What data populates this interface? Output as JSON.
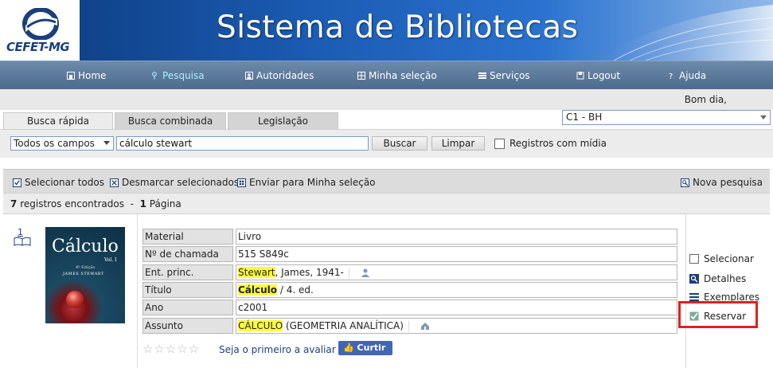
{
  "header": {
    "logo_text": "CEFET-MG",
    "site_title": "Sistema de Bibliotecas"
  },
  "nav": {
    "items": [
      {
        "label": "Home",
        "icon": "home-icon",
        "active": false
      },
      {
        "label": "Pesquisa",
        "icon": "search-icon",
        "active": true
      },
      {
        "label": "Autoridades",
        "icon": "person-card-icon",
        "active": false
      },
      {
        "label": "Minha seleção",
        "icon": "grid-icon",
        "active": false
      },
      {
        "label": "Serviços",
        "icon": "list-icon",
        "active": false
      },
      {
        "label": "Logout",
        "icon": "logout-icon",
        "active": false
      },
      {
        "label": "Ajuda",
        "icon": "help-icon",
        "active": false
      }
    ]
  },
  "greeting": "Bom dia,",
  "tabs": [
    {
      "label": "Busca rápida",
      "active": true
    },
    {
      "label": "Busca combinada",
      "active": false
    },
    {
      "label": "Legislação",
      "active": false
    }
  ],
  "branch": {
    "selected": "C1 - BH"
  },
  "search": {
    "field_selected": "Todos os campos",
    "query": "cálculo stewart",
    "search_button": "Buscar",
    "clear_button": "Limpar",
    "media_label": "Registros com mídia"
  },
  "toolbar": {
    "select_all": "Selecionar todos",
    "deselect": "Desmarcar selecionados",
    "send": "Enviar para Minha seleção",
    "new_search": "Nova pesquisa"
  },
  "results": {
    "count": "7",
    "count_text": "registros encontrados",
    "separator": "-",
    "pages": "1",
    "pages_text": "Página"
  },
  "record": {
    "number": "1",
    "cover": {
      "title": "Cálculo",
      "volume": "Vol. I",
      "edition": "4ª Edição",
      "author": "JAMES STEWART"
    },
    "fields": {
      "material_label": "Material",
      "material_value": "Livro",
      "call_label": "Nº de chamada",
      "call_value": "515 S849c",
      "author_label": "Ent. princ.",
      "author_hl": "Stewart",
      "author_rest": ", James, 1941-",
      "title_label": "Título",
      "title_hl": "Cálculo",
      "title_rest": " / 4. ed.",
      "year_label": "Ano",
      "year_value": "c2001",
      "subject_label": "Assunto",
      "subject_hl": "CÁLCULO",
      "subject_rest": " (GEOMETRIA ANALÍTICA)"
    },
    "rating_text": "Seja o primeiro a avaliar",
    "like_label": "Curtir 0",
    "actions": {
      "select": "Selecionar",
      "details": "Detalhes",
      "copies": "Exemplares",
      "reserve": "Reservar"
    }
  }
}
